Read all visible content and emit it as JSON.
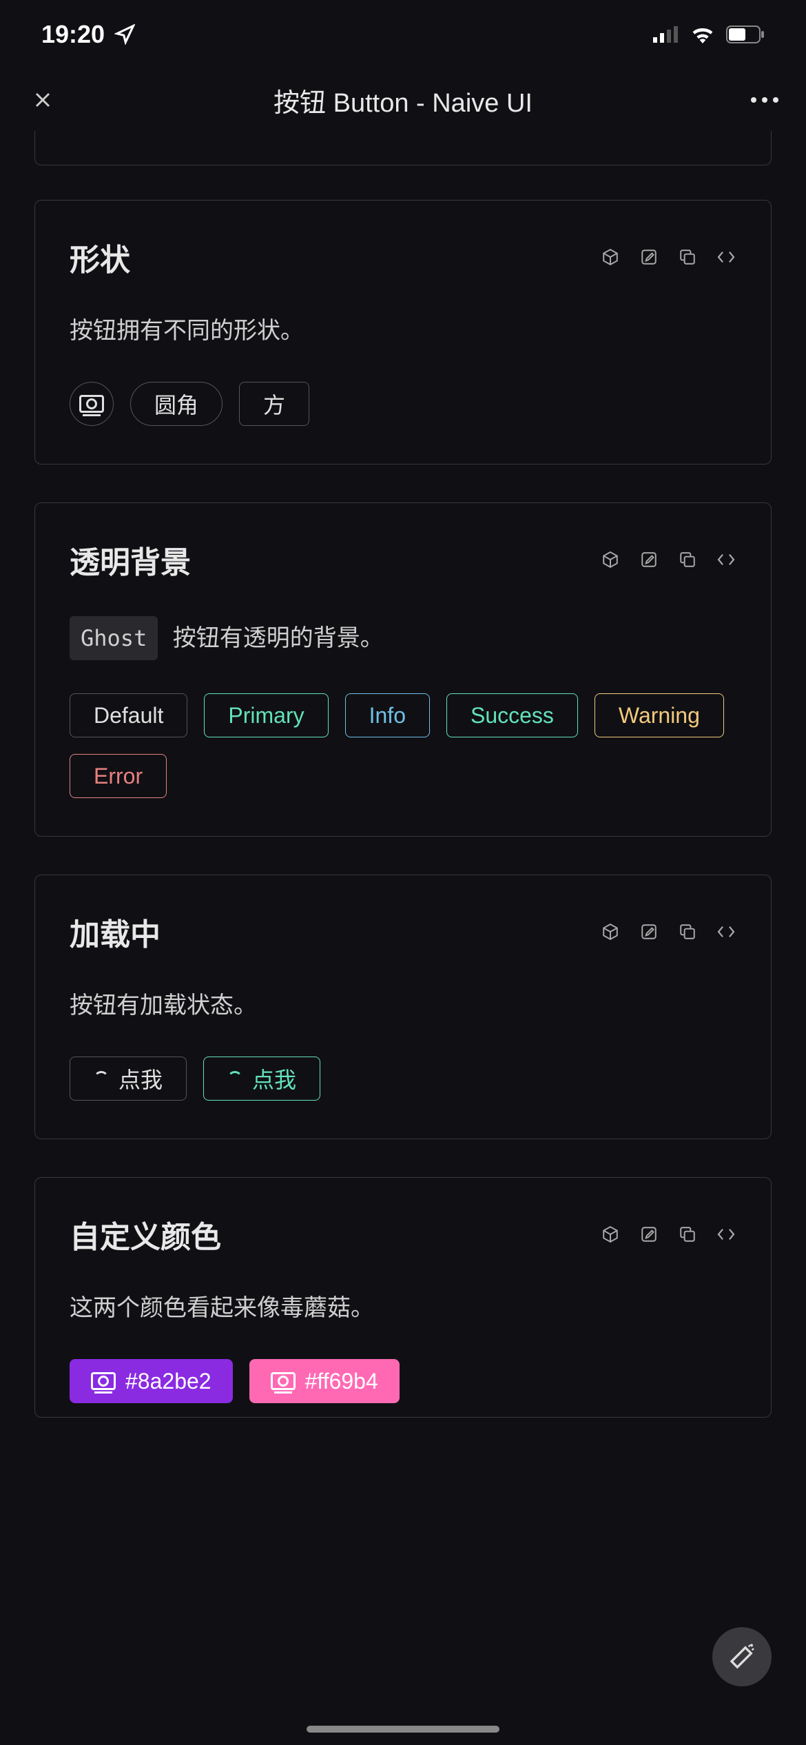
{
  "status": {
    "time": "19:20"
  },
  "header": {
    "title": "按钮 Button - Naive UI"
  },
  "sections": {
    "shape": {
      "title": "形状",
      "desc": "按钮拥有不同的形状。",
      "buttons": {
        "round": "圆角",
        "square": "方"
      }
    },
    "ghost": {
      "title": "透明背景",
      "chip": "Ghost",
      "desc_rest": "按钮有透明的背景。",
      "buttons": {
        "default": "Default",
        "primary": "Primary",
        "info": "Info",
        "success": "Success",
        "warning": "Warning",
        "error": "Error"
      }
    },
    "loading": {
      "title": "加载中",
      "desc": "按钮有加载状态。",
      "buttons": {
        "b1": "点我",
        "b2": "点我"
      }
    },
    "custom": {
      "title": "自定义颜色",
      "desc": "这两个颜色看起来像毒蘑菇。",
      "buttons": {
        "c1": "#8a2be2",
        "c2": "#ff69b4"
      }
    }
  }
}
